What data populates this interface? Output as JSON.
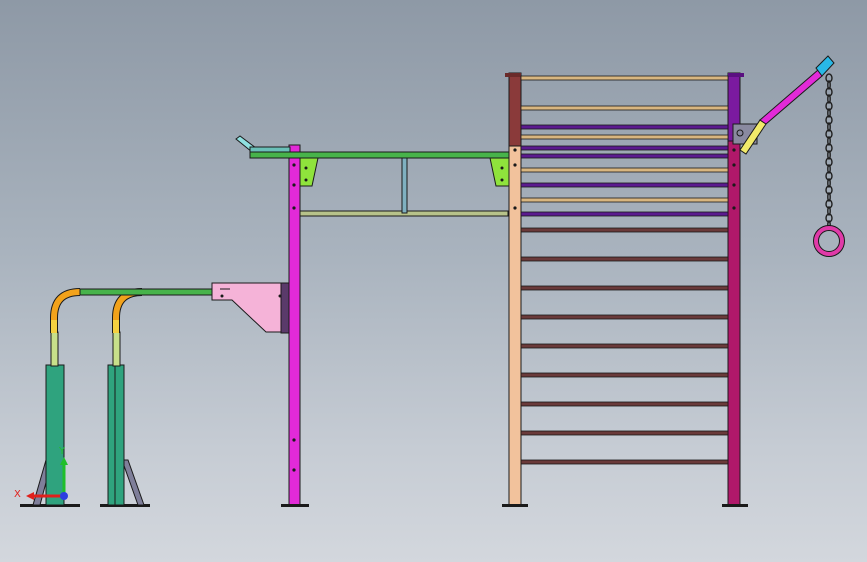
{
  "viewport": {
    "background_top": "#8e99a6",
    "background_bottom": "#d3d7dd"
  },
  "triad": {
    "x_label": "X",
    "y_label": "Y",
    "x_color": "#e0201c",
    "y_color": "#1fbf2a",
    "z_color": "#2d3fe0"
  },
  "colors": {
    "teal_post": "#2fa37e",
    "green_bar": "#47b34a",
    "orange_bend": "#f2a21b",
    "yellow_bend": "#f4d040",
    "magenta_post": "#e22ad8",
    "pink_bracket": "#f5b3d8",
    "lime_bracket": "#8fe33c",
    "steel_bar": "#7fb0c0",
    "peach_post": "#f2c29c",
    "brown_post": "#8a3a3a",
    "crimson_post": "#b0186a",
    "purple_top": "#7b1aa0",
    "rung_brown": "#6a3a3a",
    "rung_tan": "#d8b680",
    "rung_purple": "#5b1a8f",
    "chain": "#202020",
    "ring": "#e03aa8",
    "arm_cyan": "#29b8e6",
    "arm_yellow": "#f2ea6a"
  },
  "icons": {
    "triad": "coordinate-triad-icon"
  }
}
